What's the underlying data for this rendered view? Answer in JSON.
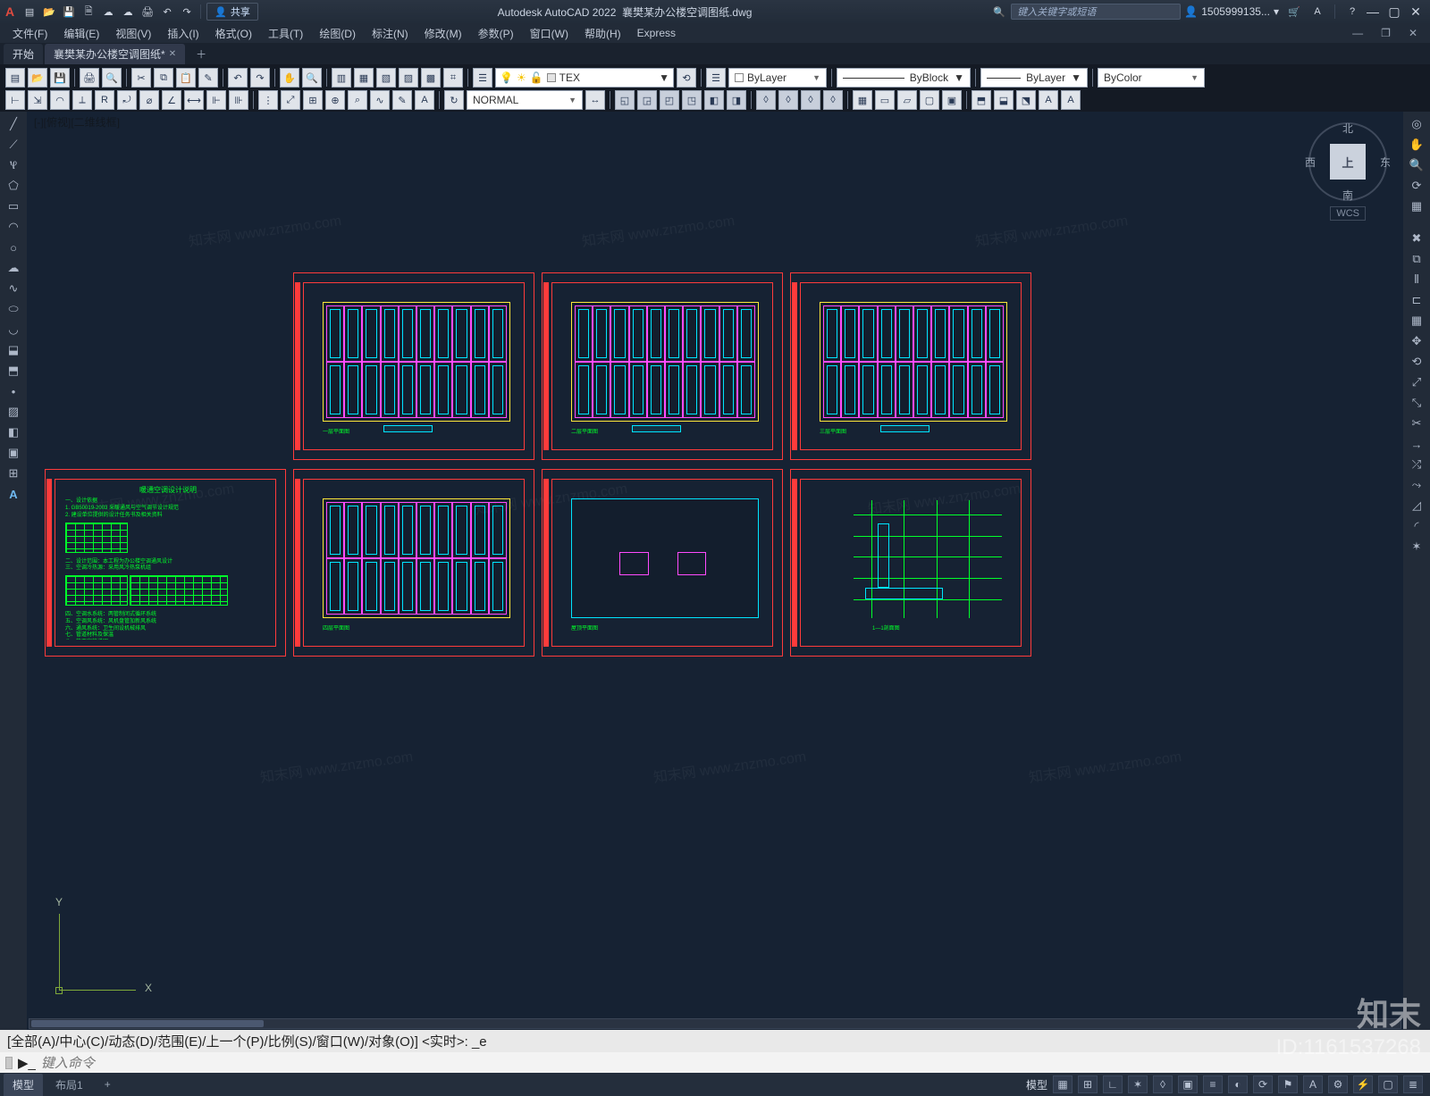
{
  "app": {
    "title_app": "Autodesk AutoCAD 2022",
    "title_file": "襄樊某办公楼空调图纸.dwg",
    "share": "共享",
    "search_placeholder": "键入关键字或短语",
    "user": "1505999135...",
    "logo": "A"
  },
  "menus": [
    "文件(F)",
    "编辑(E)",
    "视图(V)",
    "插入(I)",
    "格式(O)",
    "工具(T)",
    "绘图(D)",
    "标注(N)",
    "修改(M)",
    "参数(P)",
    "窗口(W)",
    "帮助(H)",
    "Express"
  ],
  "filetabs": {
    "start": "开始",
    "doc": "襄樊某办公楼空调图纸*"
  },
  "layer_combo": "TEX",
  "line_by": "ByLayer",
  "line_type": "ByBlock",
  "line_weight": "ByLayer",
  "color_by": "ByColor",
  "textstyle": "NORMAL",
  "viewport_label": "[-][俯视][二维线框]",
  "navcube": {
    "top": "上",
    "n": "北",
    "s": "南",
    "e": "东",
    "w": "西",
    "wcs": "WCS"
  },
  "ucs": {
    "x": "X",
    "y": "Y"
  },
  "cmd": {
    "history": "[全部(A)/中心(C)/动态(D)/范围(E)/上一个(P)/比例(S)/窗口(W)/对象(O)] <实时>: _e",
    "prompt": "▶_",
    "placeholder": "键入命令"
  },
  "status": {
    "tab_model": "模型",
    "tab_layout": "布局1",
    "plus": "+",
    "label_model": "模型"
  },
  "watermark": {
    "brand": "知末",
    "id": "ID:1161537268",
    "ghost": "知末网 www.znzmo.com"
  },
  "sheets": {
    "a": "一层平面图",
    "b": "二层平面图",
    "c": "三层平面图",
    "d": "暖通空调设计说明",
    "e": "四层平面图",
    "f": "屋顶平面图",
    "g": "1—1剖面图"
  }
}
